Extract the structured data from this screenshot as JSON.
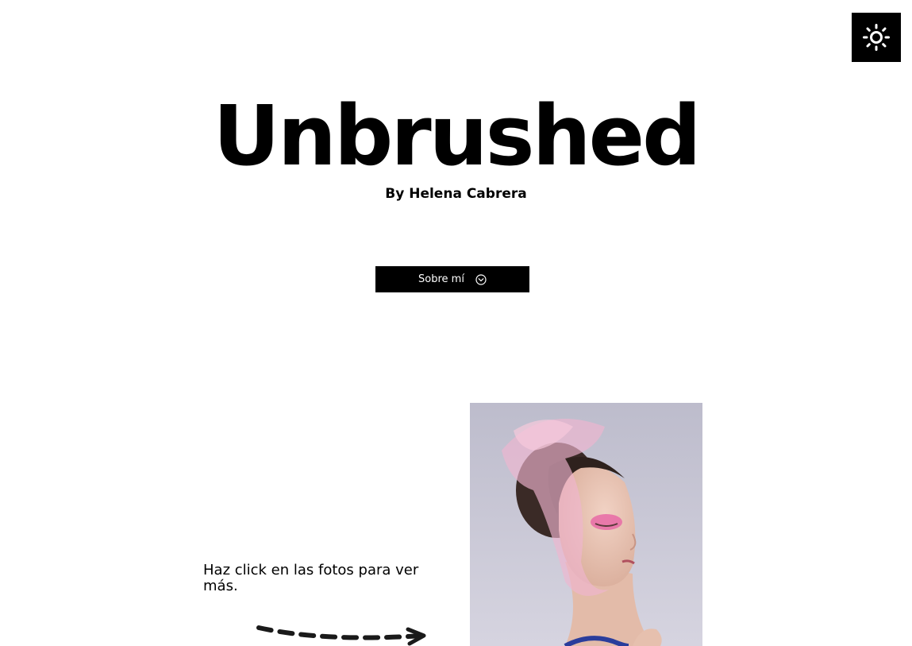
{
  "header": {
    "theme_toggle_icon": "sun-icon"
  },
  "hero": {
    "title": "Unbrushed",
    "byline": "By Helena Cabrera",
    "about_button_label": "Sobre mí",
    "about_button_icon": "chevron-down-circle-icon"
  },
  "gallery": {
    "hint_text": "Haz click en las fotos para ver más.",
    "arrow_icon": "dashed-arrow-right-icon"
  },
  "colors": {
    "background": "#ffffff",
    "text": "#000000",
    "button_bg": "#000000",
    "button_text": "#ffffff",
    "photo_backdrop": "#c9c7d6",
    "accent_pink": "#e86aa6"
  }
}
